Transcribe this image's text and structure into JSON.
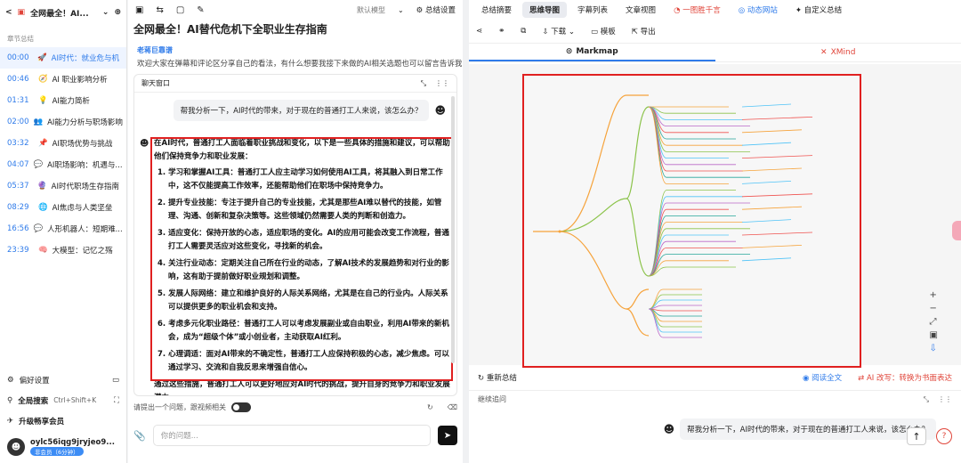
{
  "left": {
    "title": "全网最全！AI...",
    "section_label": "章节总结",
    "chapters": [
      {
        "time": "00:00",
        "emoji": "🚀",
        "title": "AI时代：就业危与机"
      },
      {
        "time": "00:46",
        "emoji": "🧭",
        "title": "AI 职业影响分析"
      },
      {
        "time": "01:31",
        "emoji": "💡",
        "title": "AI能力简析"
      },
      {
        "time": "02:00",
        "emoji": "👥",
        "title": "AI能力分析与职场影响"
      },
      {
        "time": "03:32",
        "emoji": "📌",
        "title": "AI职场优势与挑战"
      },
      {
        "time": "04:07",
        "emoji": "💬",
        "title": "AI职场影响：机遇与..."
      },
      {
        "time": "05:37",
        "emoji": "🔮",
        "title": "AI时代职场生存指南"
      },
      {
        "time": "08:29",
        "emoji": "🌐",
        "title": "AI焦虑与人类坚垒"
      },
      {
        "time": "16:56",
        "emoji": "💬",
        "title": "人形机器人：短期难..."
      },
      {
        "time": "23:39",
        "emoji": "🧠",
        "title": "大模型：记忆之殇"
      }
    ],
    "preferences": "偏好设置",
    "global_search": "全局搜索",
    "shortcut": "Ctrl+Shift+K",
    "upgrade": "升级畅享会员",
    "username": "oylc56iqg9jryjeo9...",
    "vip_badge": "非会员（6分钟）"
  },
  "middle": {
    "model": "默认模型",
    "settings": "总结设置",
    "title": "全网最全！AI替代危机下全职业生存指南",
    "author": "老蒋巨靠谱",
    "description": "欢迎大家在弹幕和评论区分享自己的看法，有什么想要我接下来做的AI相关选题也可以留言告诉我",
    "chat_title": "聊天窗口",
    "question": "帮我分析一下，AI时代的带来，对于现在的普通打工人来说，该怎么办？",
    "answer_intro": "在AI时代，普通打工人面临着职业挑战和变化，以下是一些具体的措施和建议，可以帮助他们保持竞争力和职业发展：",
    "answer_items": [
      "1. 学习和掌握AI工具：普通打工人应主动学习如何使用AI工具，将其融入到日常工作中，这不仅能提高工作效率，还能帮助他们在职场中保持竞争力。",
      "2. 提升专业技能：专注于提升自己的专业技能，尤其是那些AI难以替代的技能，如管理、沟通、创新和复杂决策等。这些领域仍然需要人类的判断和创造力。",
      "3. 适应变化：保持开放的心态，适应职场的变化。AI的应用可能会改变工作流程，普通打工人需要灵活应对这些变化，寻找新的机会。",
      "4. 关注行业动态：定期关注自己所在行业的动态，了解AI技术的发展趋势和对行业的影响，这有助于提前做好职业规划和调整。",
      "5. 发展人际网络：建立和维护良好的人际关系网络，尤其是在自己的行业内。人际关系可以提供更多的职业机会和支持。",
      "6. 考虑多元化职业路径：普通打工人可以考虑发展副业或自由职业，利用AI带来的新机会，成为“超级个体”或小创业者，主动获取AI红利。",
      "7. 心理调适：面对AI带来的不确定性，普通打工人应保持积极的心态，减少焦虑。可以通过学习、交流和自我反思来增强自信心。"
    ],
    "answer_outro": "通过这些措施，普通打工人可以更好地应对AI时代的挑战，提升自身的竞争力和职业发展潜力。",
    "hint": "请提出一个问题，跟视频相关",
    "input_placeholder": "你的问题..."
  },
  "right": {
    "tabs": [
      "总结摘要",
      "思维导图",
      "字幕列表",
      "文章视图",
      "一图胜千言",
      "动态网站",
      "自定义总结"
    ],
    "active_tab": "思维导图",
    "tools": [
      "下载",
      "模板",
      "导出"
    ],
    "view_markmap": "Markmap",
    "view_xmind": "XMind",
    "regenerate": "重新总结",
    "read_full": "阅读全文",
    "ai_rewrite": "AI 改写：转换为书面表达",
    "follow_up": "继续追问",
    "question": "帮我分析一下，AI时代的带来，对于现在的普通打工人来说，该怎么办？",
    "colors": {
      "accent": "#2f7bea",
      "red": "#e02020"
    }
  }
}
